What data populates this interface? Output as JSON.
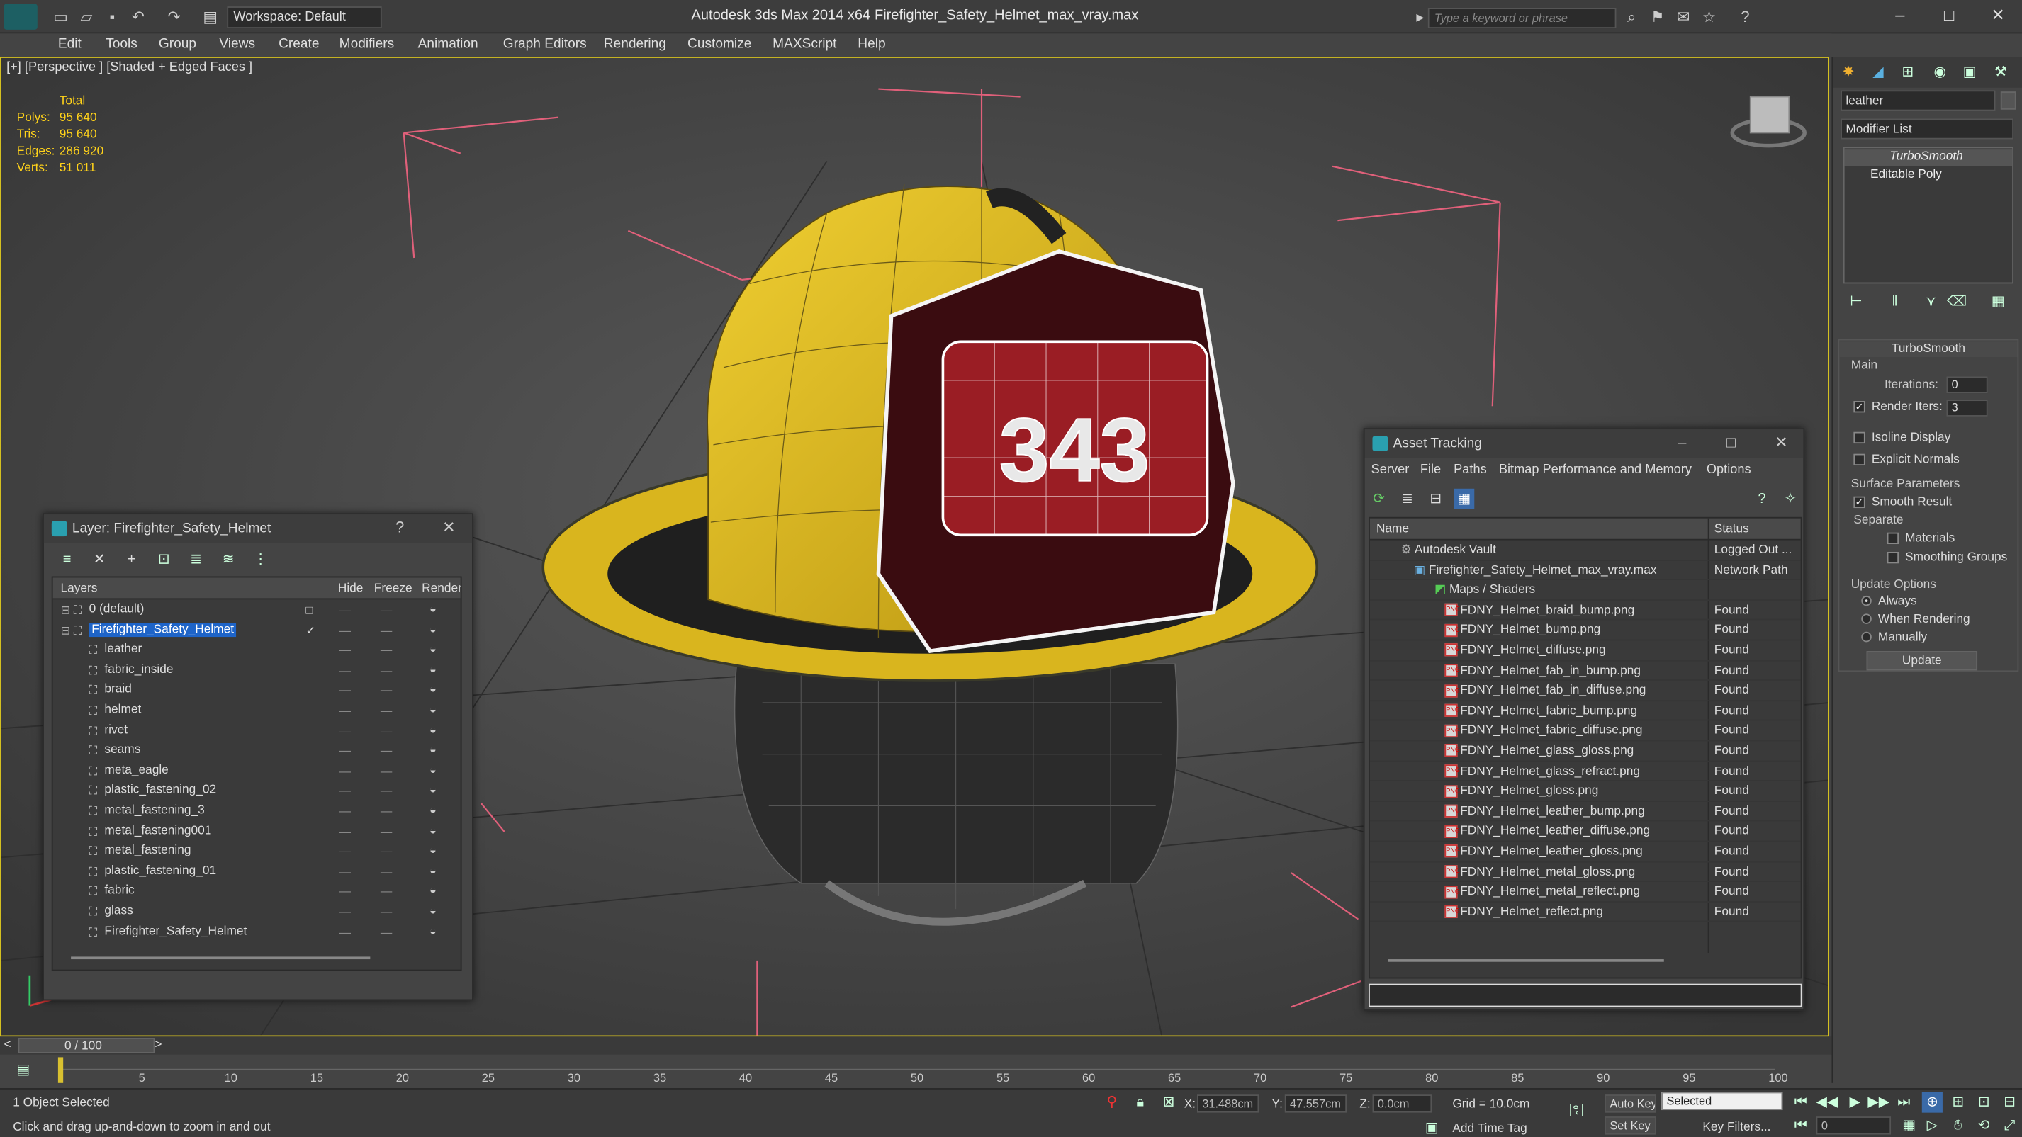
{
  "app": {
    "title": "Autodesk 3ds Max  2014 x64",
    "file": "Firefighter_Safety_Helmet_max_vray.max",
    "workspace": "Workspace: Default",
    "search_placeholder": "Type a keyword or phrase"
  },
  "menu": [
    "Edit",
    "Tools",
    "Group",
    "Views",
    "Create",
    "Modifiers",
    "Animation",
    "Graph Editors",
    "Rendering",
    "Customize",
    "MAXScript",
    "Help"
  ],
  "viewport": {
    "label": "[+] [Perspective ] [Shaded + Edged Faces ]",
    "stats": {
      "header": "Total",
      "rows": [
        {
          "k": "Polys:",
          "v": "95 640"
        },
        {
          "k": "Tris:",
          "v": "95 640"
        },
        {
          "k": "Edges:",
          "v": "286 920"
        },
        {
          "k": "Verts:",
          "v": "51 011"
        }
      ]
    },
    "helmet_number": "343"
  },
  "command_panel": {
    "object_name": "leather",
    "modifier_list": "Modifier List",
    "stack": [
      "TurboSmooth",
      "Editable Poly"
    ],
    "rollout_title": "TurboSmooth",
    "main_label": "Main",
    "iterations_label": "Iterations:",
    "iterations_value": "0",
    "render_iters_label": "Render Iters:",
    "render_iters_value": "3",
    "isoline": "Isoline Display",
    "explicit_normals": "Explicit Normals",
    "surface_params": "Surface Parameters",
    "smooth_result": "Smooth Result",
    "separate": "Separate",
    "materials": "Materials",
    "smoothing_groups": "Smoothing Groups",
    "update_options": "Update Options",
    "always": "Always",
    "when_rendering": "When Rendering",
    "manually": "Manually",
    "update_button": "Update"
  },
  "layer_window": {
    "title": "Layer: Firefighter_Safety_Helmet",
    "help": "?",
    "columns": {
      "layers": "Layers",
      "hide": "Hide",
      "freeze": "Freeze",
      "render": "Render"
    },
    "rows": [
      {
        "name": "0 (default)",
        "level": 0
      },
      {
        "name": "Firefighter_Safety_Helmet",
        "level": 0,
        "selected": true
      },
      {
        "name": "leather",
        "level": 1
      },
      {
        "name": "fabric_inside",
        "level": 1
      },
      {
        "name": "braid",
        "level": 1
      },
      {
        "name": "helmet",
        "level": 1
      },
      {
        "name": "rivet",
        "level": 1
      },
      {
        "name": "seams",
        "level": 1
      },
      {
        "name": "meta_eagle",
        "level": 1
      },
      {
        "name": "plastic_fastening_02",
        "level": 1
      },
      {
        "name": "metal_fastening_3",
        "level": 1
      },
      {
        "name": "metal_fastening001",
        "level": 1
      },
      {
        "name": "metal_fastening",
        "level": 1
      },
      {
        "name": "plastic_fastening_01",
        "level": 1
      },
      {
        "name": "fabric",
        "level": 1
      },
      {
        "name": "glass",
        "level": 1
      },
      {
        "name": "Firefighter_Safety_Helmet",
        "level": 1
      }
    ]
  },
  "asset_window": {
    "title": "Asset Tracking",
    "menu": [
      "Server",
      "File",
      "Paths",
      "Bitmap Performance and Memory",
      "Options"
    ],
    "columns": {
      "name": "Name",
      "status": "Status"
    },
    "rows": [
      {
        "name": "Autodesk Vault",
        "status": "Logged Out ...",
        "indent": 0
      },
      {
        "name": "Firefighter_Safety_Helmet_max_vray.max",
        "status": "Network Path",
        "indent": 1
      },
      {
        "name": "Maps / Shaders",
        "status": "",
        "indent": 2
      },
      {
        "name": "FDNY_Helmet_braid_bump.png",
        "status": "Found",
        "indent": 3
      },
      {
        "name": "FDNY_Helmet_bump.png",
        "status": "Found",
        "indent": 3
      },
      {
        "name": "FDNY_Helmet_diffuse.png",
        "status": "Found",
        "indent": 3
      },
      {
        "name": "FDNY_Helmet_fab_in_bump.png",
        "status": "Found",
        "indent": 3
      },
      {
        "name": "FDNY_Helmet_fab_in_diffuse.png",
        "status": "Found",
        "indent": 3
      },
      {
        "name": "FDNY_Helmet_fabric_bump.png",
        "status": "Found",
        "indent": 3
      },
      {
        "name": "FDNY_Helmet_fabric_diffuse.png",
        "status": "Found",
        "indent": 3
      },
      {
        "name": "FDNY_Helmet_glass_gloss.png",
        "status": "Found",
        "indent": 3
      },
      {
        "name": "FDNY_Helmet_glass_refract.png",
        "status": "Found",
        "indent": 3
      },
      {
        "name": "FDNY_Helmet_gloss.png",
        "status": "Found",
        "indent": 3
      },
      {
        "name": "FDNY_Helmet_leather_bump.png",
        "status": "Found",
        "indent": 3
      },
      {
        "name": "FDNY_Helmet_leather_diffuse.png",
        "status": "Found",
        "indent": 3
      },
      {
        "name": "FDNY_Helmet_leather_gloss.png",
        "status": "Found",
        "indent": 3
      },
      {
        "name": "FDNY_Helmet_metal_gloss.png",
        "status": "Found",
        "indent": 3
      },
      {
        "name": "FDNY_Helmet_metal_reflect.png",
        "status": "Found",
        "indent": 3
      },
      {
        "name": "FDNY_Helmet_reflect.png",
        "status": "Found",
        "indent": 3
      }
    ]
  },
  "timeline": {
    "frame": "0 / 100",
    "ticks": [
      "5",
      "10",
      "15",
      "20",
      "25",
      "30",
      "35",
      "40",
      "45",
      "50",
      "55",
      "60",
      "65",
      "70",
      "75",
      "80",
      "85",
      "90",
      "95",
      "100"
    ]
  },
  "status": {
    "selected": "1 Object Selected",
    "prompt": "Click and drag up-and-down to zoom in and out",
    "x_label": "X:",
    "x": "31.488cm",
    "y_label": "Y:",
    "y": "47.557cm",
    "z_label": "Z:",
    "z": "0.0cm",
    "grid": "Grid = 10.0cm",
    "auto_key": "Auto Key",
    "set_key": "Set Key",
    "key_mode": "Selected",
    "key_filters": "Key Filters...",
    "add_time_tag": "Add Time Tag",
    "frame_value": "0"
  },
  "colors": {
    "selection": "#1e64c8",
    "stats": "#ffd21a",
    "viewport_border": "#d4c020",
    "helmet": "#e8c020"
  }
}
